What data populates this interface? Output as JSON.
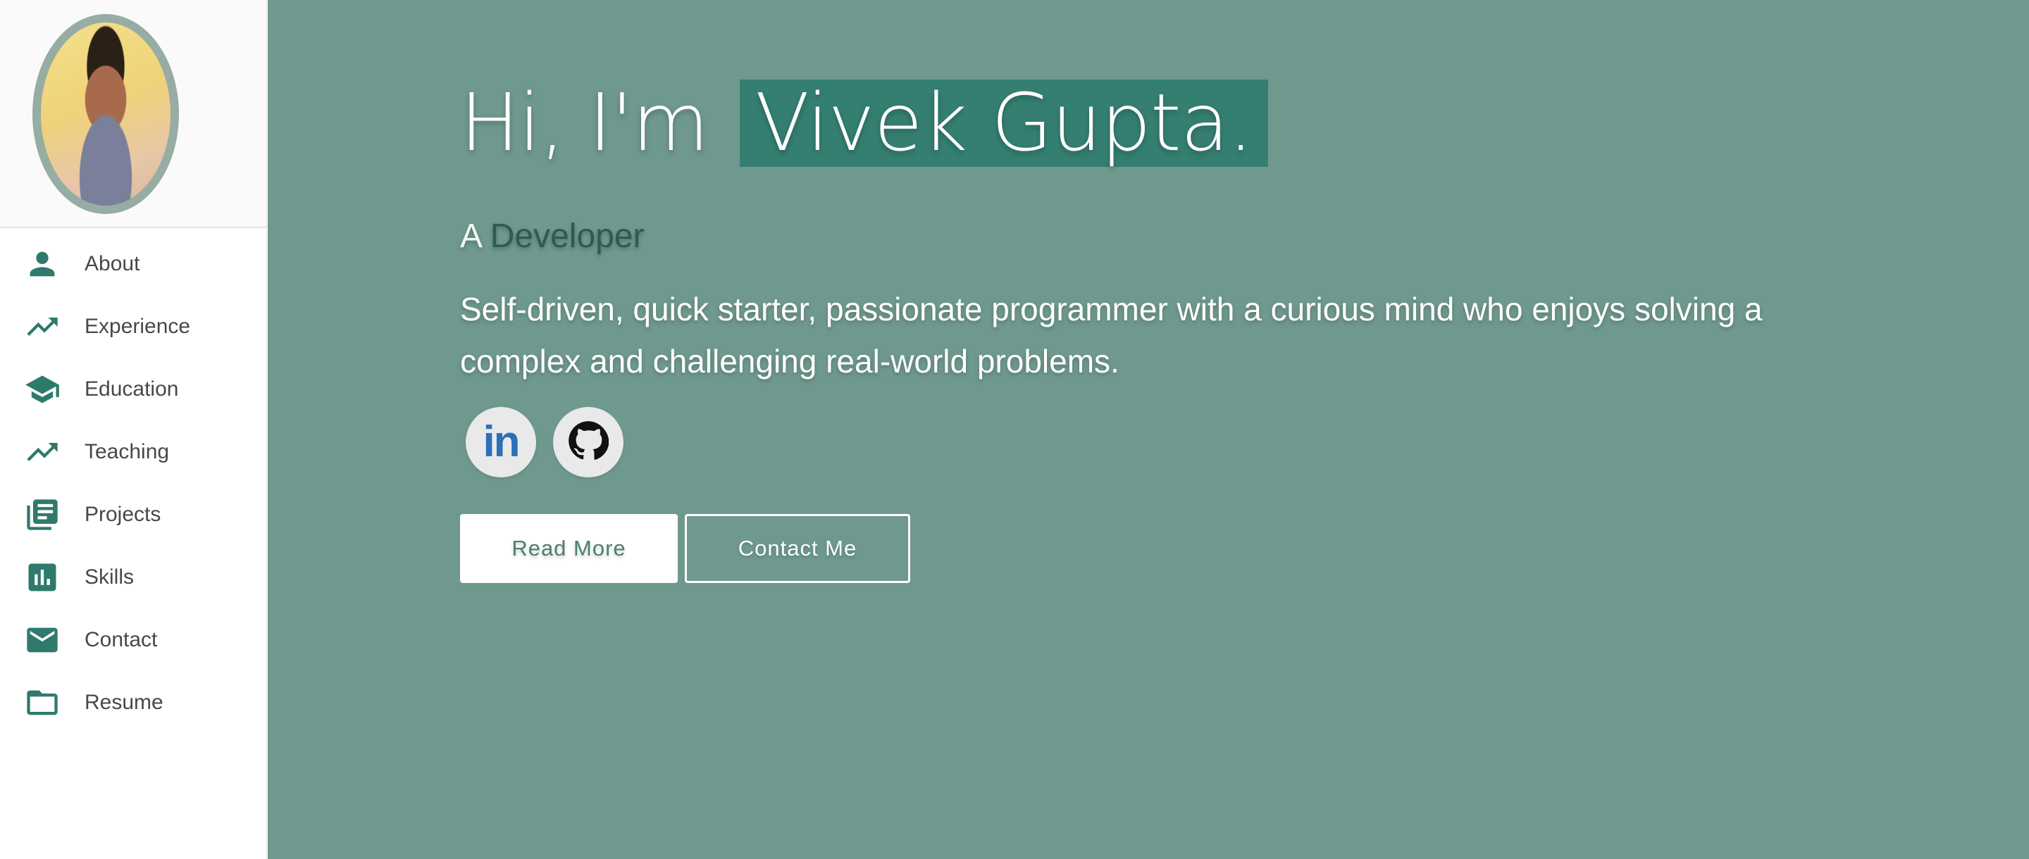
{
  "sidebar": {
    "items": [
      {
        "label": "About",
        "icon": "person-icon"
      },
      {
        "label": "Experience",
        "icon": "trending-up-icon"
      },
      {
        "label": "Education",
        "icon": "graduation-cap-icon"
      },
      {
        "label": "Teaching",
        "icon": "trending-up-icon"
      },
      {
        "label": "Projects",
        "icon": "library-books-icon"
      },
      {
        "label": "Skills",
        "icon": "bar-chart-icon"
      },
      {
        "label": "Contact",
        "icon": "mail-icon"
      },
      {
        "label": "Resume",
        "icon": "folder-icon"
      }
    ]
  },
  "hero": {
    "greeting": "Hi, I'm",
    "name": "Vivek Gupta.",
    "role_prefix": "A",
    "role": "Developer",
    "description": "Self-driven, quick starter, passionate programmer with a curious mind who enjoys solving a complex and challenging real-world problems.",
    "buttons": {
      "read_more": "Read More",
      "contact": "Contact Me"
    }
  },
  "colors": {
    "accent": "#2f7a6d",
    "hero_background": "#6f998e",
    "name_highlight": "#357f72",
    "role_text": "#2f5a50",
    "linkedin": "#2d6fb8"
  }
}
